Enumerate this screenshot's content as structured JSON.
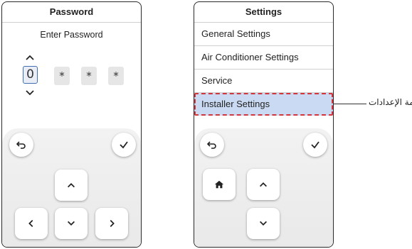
{
  "left_screen": {
    "title": "Password",
    "subtitle": "Enter Password",
    "digits": [
      "0",
      "*",
      "*",
      "*"
    ]
  },
  "right_screen": {
    "title": "Settings",
    "menu_items": [
      "General Settings",
      "Air Conditioner Settings",
      "Service",
      "Installer Settings"
    ]
  },
  "callout": {
    "text": "قائمة الإعدادات"
  },
  "colors": {
    "highlight_fill": "#c9daf2",
    "highlight_border": "#d2353c",
    "active_digit_border": "#3f6fb3"
  },
  "icons": {
    "back": "back-arrow-icon",
    "confirm": "checkmark-icon",
    "home": "home-icon",
    "up": "chevron-up-icon",
    "down": "chevron-down-icon",
    "left": "chevron-left-icon",
    "right": "chevron-right-icon"
  }
}
